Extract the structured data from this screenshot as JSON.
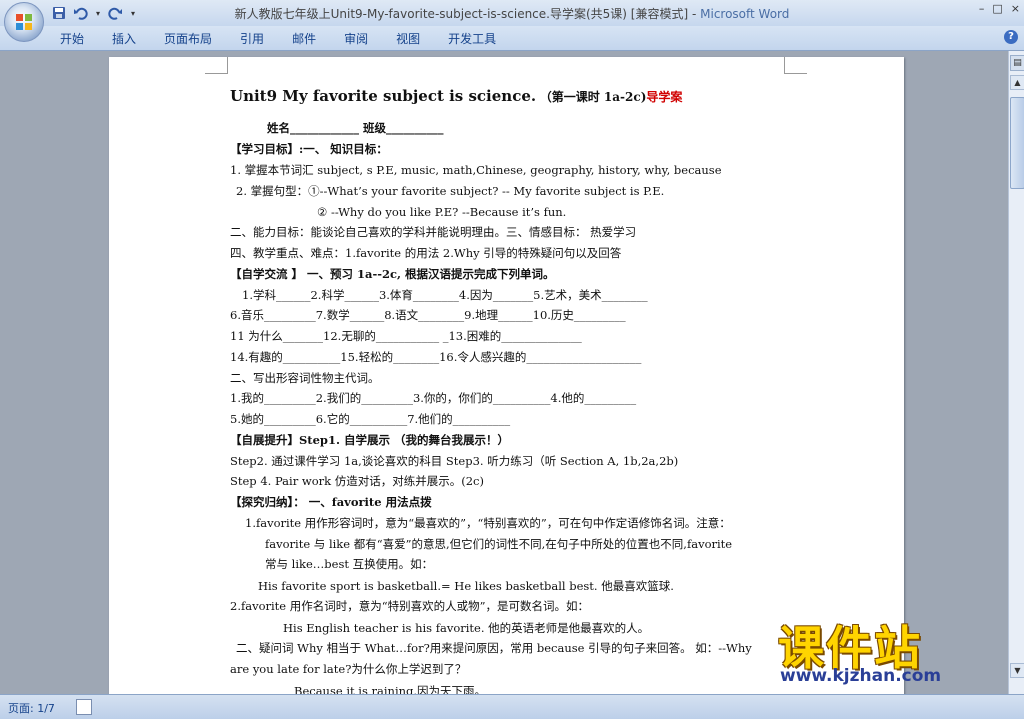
{
  "window": {
    "title": "新人教版七年级上Unit9-My-favorite-subject-is-science.导学案(共5课) [兼容模式] - ",
    "app_name": "Microsoft Word",
    "controls": [
      "–",
      "□",
      "×"
    ]
  },
  "ribbon": {
    "tabs": [
      "开始",
      "插入",
      "页面布局",
      "引用",
      "邮件",
      "审阅",
      "视图",
      "开发工具"
    ],
    "help": "?"
  },
  "document": {
    "heading_en": "Unit9 My favorite subject is science.",
    "heading_cn_small": "（第一课时 1a-2c)",
    "heading_cn_red": "导学案",
    "lines": [
      "姓名____________              班级__________",
      "【学习目标】:一、  知识目标：",
      "1. 掌握本节词汇 subject, s P.E,  music, math,Chinese, geography, history,  why, because",
      "2. 掌握句型：①--What’s  your favorite subject?    -- My favorite subject is  P.E.",
      "② --Why  do you like P.E?                 --Because it’s  fun.",
      "二、能力目标：能谈论自己喜欢的学科并能说明理由。三、情感目标：  热爱学习",
      "四、教学重点、难点：1.favorite 的用法     2.Why 引导的特殊疑问句以及回答",
      "【自学交流 】  一、预习 1a--2c,  根据汉语提示完成下列单词。",
      "1.学科______2.科学______3.体育________4.因为_______5.艺术，美术________",
      "6.音乐_________7.数学______8.语文________9.地理______10.历史_________",
      "11 为什么_______12.无聊的___________ _13.困难的______________",
      "14.有趣的__________15.轻松的________16.令人感兴趣的____________________",
      "二、写出形容词性物主代词。",
      "1.我的_________2.我们的_________3.你的，你们的__________4.他的_________",
      "5.她的_________6.它的__________7.他们的__________",
      "【自展提升】Step1. 自学展示   （我的舞台我展示！）",
      "Step2. 通过课件学习 1a,谈论喜欢的科目 Step3.   听力练习（听 Section  A,  1b,2a,2b)",
      "Step 4. Pair work  仿造对话，对练并展示。(2c)",
      "【探究归纳】：    一、favorite  用法点拨",
      "1.favorite 用作形容词时，意为“最喜欢的”，“特别喜欢的”，可在句中作定语修饰名词。注意：",
      "favorite 与 like 都有“喜爱”的意思,但它们的词性不同,在句子中所处的位置也不同,favorite",
      "常与 like…best 互换使用。如：",
      "His favorite sport is basketball.= He likes  basketball best.  他最喜欢篮球.",
      "2.favorite 用作名词时，意为“特别喜欢的人或物”，是可数名词。如：",
      "His English  teacher is his favorite.  他的英语老师是他最喜欢的人。",
      "二、疑问词 Why  相当于 What…for?用来提问原因，常用 because 引导的句子来回答。  如：--Why",
      "are you late for late?为什么你上学迟到了？",
      "Because it is raining.因为天下雨。"
    ]
  },
  "statusbar": {
    "page": "页面: 1/7"
  },
  "watermark": {
    "text": "课件站",
    "url": "www.kjzhan.com"
  }
}
